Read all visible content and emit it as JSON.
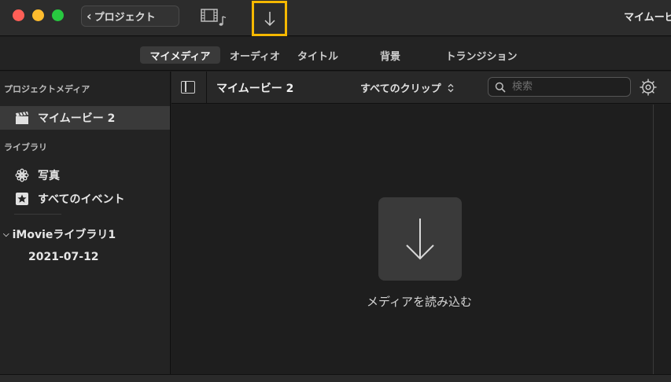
{
  "titlebar": {
    "back_label": "プロジェクト",
    "window_title": "マイムービー"
  },
  "tabs": [
    {
      "label": "マイメディア",
      "active": true
    },
    {
      "label": "オーディオ",
      "active": false
    },
    {
      "label": "タイトル",
      "active": false
    },
    {
      "label": "背景",
      "active": false
    },
    {
      "label": "トランジション",
      "active": false
    }
  ],
  "sidebar": {
    "project_media_header": "プロジェクトメディア",
    "project_item": "マイムービー 2",
    "library_header": "ライブラリ",
    "photos": "写真",
    "all_events": "すべてのイベント",
    "library_name": "iMovieライブラリ1",
    "event_date": "2021-07-12"
  },
  "content_toolbar": {
    "project_title": "マイムービー 2",
    "clip_filter": "すべてのクリップ",
    "search_placeholder": "検索"
  },
  "content": {
    "import_label": "メディアを読み込む"
  },
  "colors": {
    "accent_highlight": "#f5b800",
    "window_bg": "#1e1e1e",
    "selected_row": "#3a3a3a"
  }
}
